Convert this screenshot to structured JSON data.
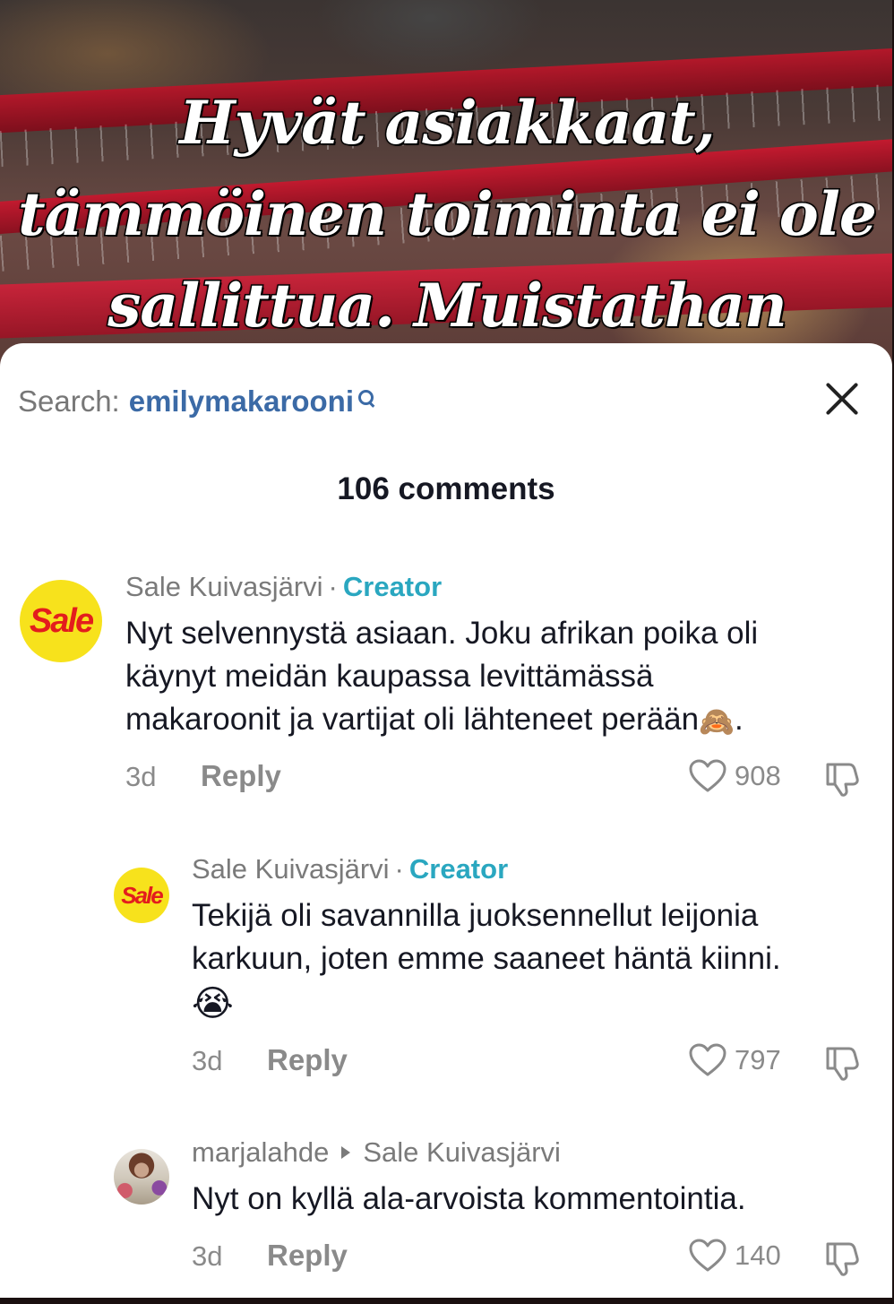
{
  "video": {
    "caption_lines": [
      "Hyvät asiakkaat,",
      "tämmöinen toiminta ei ole",
      "sallittua. Muistathan"
    ]
  },
  "sheet": {
    "search_label": "Search:",
    "search_term": "emilymakarooni",
    "close_icon": "close-icon",
    "comments_count": "106 comments"
  },
  "comments": [
    {
      "author": "Sale Kuivasjärvi",
      "separator": "·",
      "badge": "Creator",
      "avatar_text": "Sale",
      "lines": [
        "Nyt selvennystä asiaan. Joku afrikan poika oli",
        "käynyt meidän kaupassa levittämässä",
        "makaroonit ja vartijat oli lähteneet perään"
      ],
      "emoji": "🙈",
      "trailing": ".",
      "time": "3d",
      "reply": "Reply",
      "likes": "908"
    },
    {
      "author": "Sale Kuivasjärvi",
      "separator": "·",
      "badge": "Creator",
      "avatar_text": "Sale",
      "lines": [
        "Tekijä oli savannilla juoksennellut leijonia",
        "karkuun, joten emme saaneet häntä kiinni."
      ],
      "emoji": "😭",
      "time": "3d",
      "reply": "Reply",
      "likes": "797"
    },
    {
      "author": "marjalahde",
      "reply_to": "Sale Kuivasjärvi",
      "lines": [
        "Nyt on kyllä ala-arvoista kommentointia."
      ],
      "time": "3d",
      "reply": "Reply",
      "likes": "140"
    }
  ],
  "colors": {
    "creator_badge": "#2aa7c0",
    "search_term": "#3b6aa6",
    "sale_yellow": "#f7e21c",
    "sale_red": "#e31d1d"
  }
}
